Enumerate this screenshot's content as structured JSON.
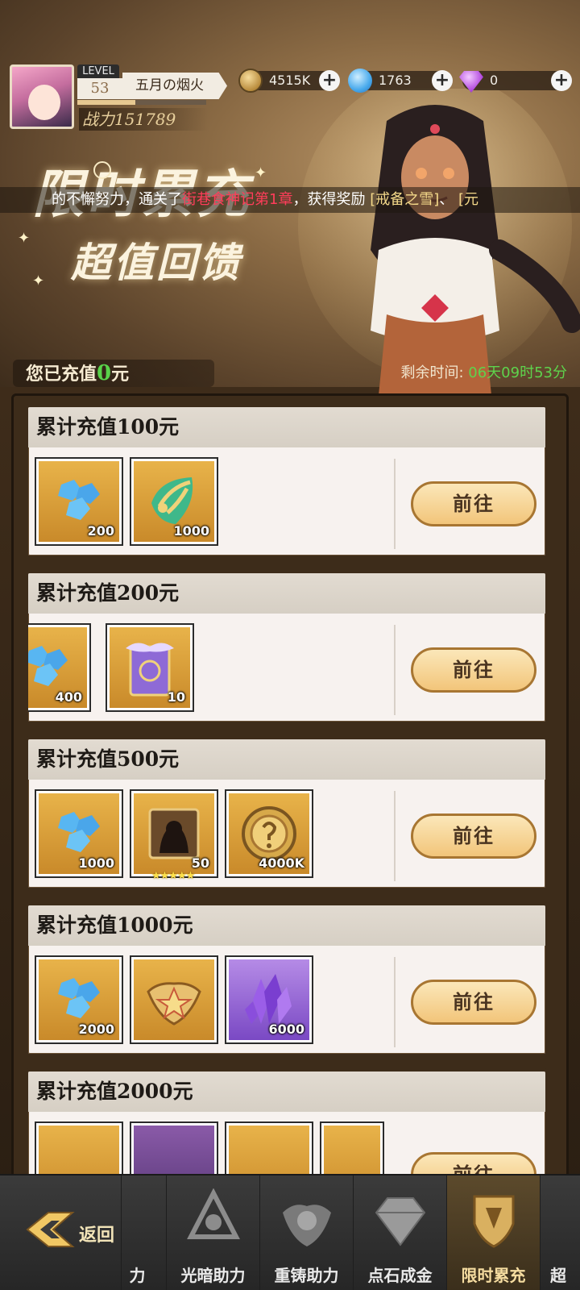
{
  "player": {
    "level_label": "LEVEL",
    "level": "53",
    "name": "五月の烟火",
    "power": "战力151789",
    "exp_fraction": 0.45
  },
  "resources": {
    "coins": "4515K",
    "gems": "1763",
    "diamonds": "0"
  },
  "banner": {
    "title_line1": "限时累充",
    "title_line2": "超值回馈"
  },
  "ticker": {
    "part1": "的不懈努力，通关了",
    "highlight": "街巷食神记第1章",
    "part2": "，获得奖励",
    "reward": "[戒备之雪]",
    "part3": "、",
    "tail": "[元"
  },
  "status": {
    "recharged_prefix": "您已充值",
    "recharged_amount": "0",
    "recharged_suffix": "元",
    "remaining_label": "剩余时间:",
    "remaining_time": "06天09时53分"
  },
  "tiers": [
    {
      "title": "累计充值100元",
      "button": "前往",
      "items": [
        {
          "icon": "blue-gem-icon",
          "qty": "200"
        },
        {
          "icon": "leaf-token-icon",
          "qty": "1000"
        }
      ]
    },
    {
      "title": "累计充值200元",
      "button": "前往",
      "items": [
        {
          "icon": "blue-gem-icon",
          "qty": "400"
        },
        {
          "icon": "purple-card-icon",
          "qty": "10"
        }
      ]
    },
    {
      "title": "累计充值500元",
      "button": "前往",
      "items": [
        {
          "icon": "blue-gem-icon",
          "qty": "1000"
        },
        {
          "icon": "hero-shard-icon",
          "qty": "50",
          "stars": "★★★★★"
        },
        {
          "icon": "gold-coin-icon",
          "qty": "4000K"
        }
      ]
    },
    {
      "title": "累计充值1000元",
      "button": "前往",
      "items": [
        {
          "icon": "blue-gem-icon",
          "qty": "2000"
        },
        {
          "icon": "medal-emblem-icon",
          "qty": ""
        },
        {
          "icon": "purple-crystal-icon",
          "qty": "6000"
        }
      ]
    },
    {
      "title": "累计充值2000元",
      "button": "前往",
      "items": []
    }
  ],
  "nav": {
    "back": "返回",
    "tabs": [
      "力",
      "光暗助力",
      "重铸助力",
      "点石成金",
      "限时累充",
      "超"
    ]
  },
  "colors": {
    "accent_gold": "#f2c57a",
    "highlight_green": "#5ed34c",
    "ticker_red": "#ff3d5a"
  }
}
